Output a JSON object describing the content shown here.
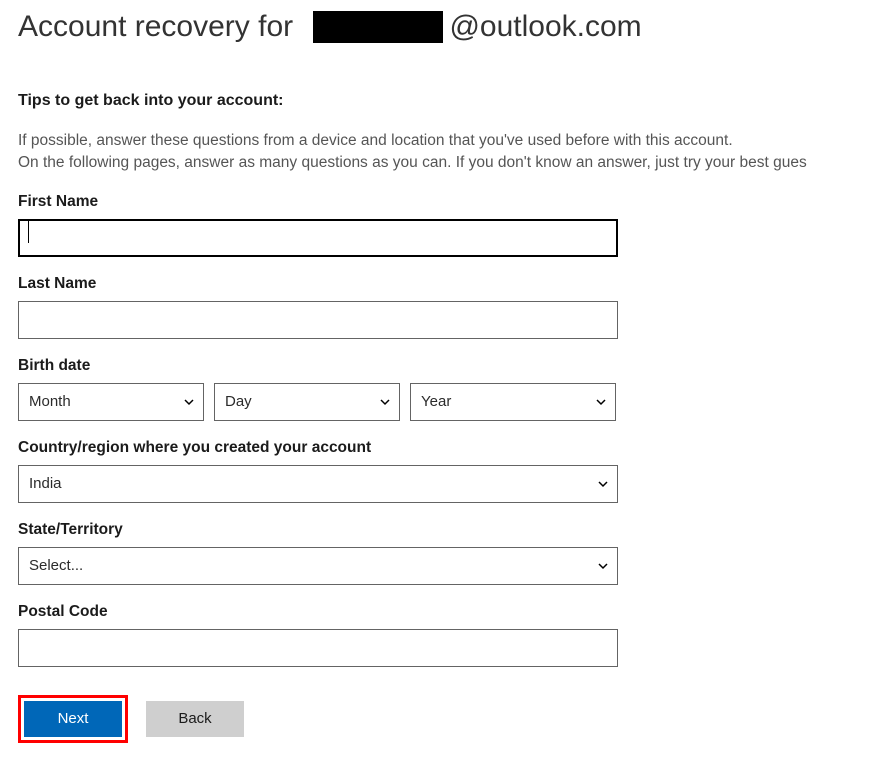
{
  "header": {
    "title_prefix": "Account recovery for",
    "email_suffix": "@outlook.com"
  },
  "tips": {
    "heading": "Tips to get back into your account:",
    "line1": "If possible, answer these questions from a device and location that you've used before with this account.",
    "line2": "On the following pages, answer as many questions as you can. If you don't know an answer, just try your best gues"
  },
  "form": {
    "first_name": {
      "label": "First Name",
      "value": ""
    },
    "last_name": {
      "label": "Last Name",
      "value": ""
    },
    "birth_date": {
      "label": "Birth date",
      "month": "Month",
      "day": "Day",
      "year": "Year"
    },
    "country": {
      "label": "Country/region where you created your account",
      "value": "India"
    },
    "state": {
      "label": "State/Territory",
      "value": "Select..."
    },
    "postal": {
      "label": "Postal Code",
      "value": ""
    }
  },
  "buttons": {
    "next": "Next",
    "back": "Back"
  }
}
